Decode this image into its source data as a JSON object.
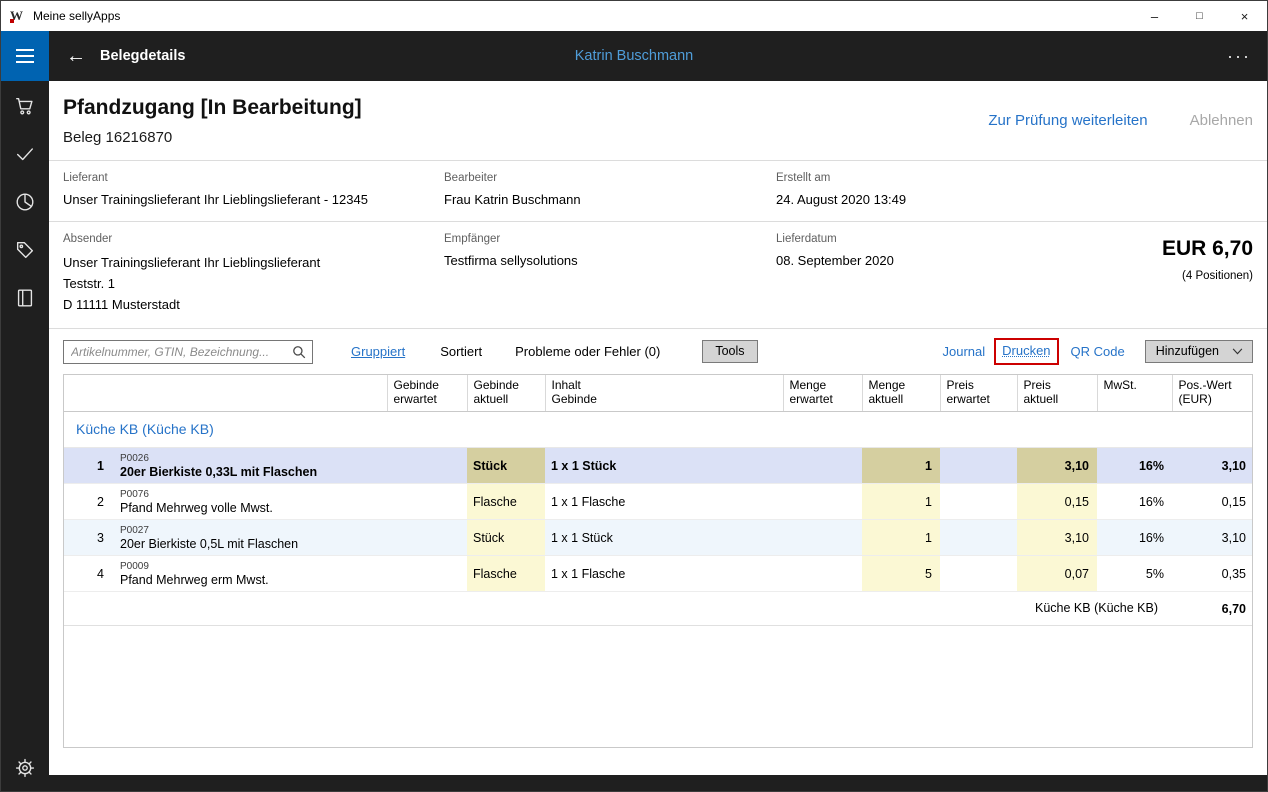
{
  "colors": {
    "accent": "#2673c8",
    "header_user_blue": "#4f9dd9",
    "hamburger_blue": "#0063b1",
    "dark_chrome": "#1f1f1f",
    "selected_row": "#dbe1f6",
    "editable_cell_yellow": "#fbf8d4",
    "editable_cell_selected_khaki": "#d5cfa0",
    "focus_highlight_red": "#cc0000"
  },
  "window": {
    "title": "Meine sellyApps",
    "minimize": "–",
    "maximize": "□",
    "close": "×"
  },
  "header": {
    "back": "←",
    "title": "Belegdetails",
    "user": "Katrin Buschmann",
    "more": "···"
  },
  "sidebar": {
    "icons": [
      "cart-icon",
      "check-icon",
      "pie-chart-icon",
      "tag-icon",
      "book-icon",
      "gear-icon"
    ]
  },
  "document": {
    "title": "Pfandzugang [In Bearbeitung]",
    "subtitle": "Beleg 16216870",
    "forward_action": "Zur Prüfung weiterleiten",
    "reject_action": "Ablehnen",
    "fields": {
      "lieferant": {
        "label": "Lieferant",
        "value": "Unser Trainingslieferant Ihr Lieblingslieferant - 12345"
      },
      "bearbeiter": {
        "label": "Bearbeiter",
        "value": "Frau Katrin Buschmann"
      },
      "erstellt": {
        "label": "Erstellt am",
        "value": "24. August 2020 13:49"
      },
      "absender": {
        "label": "Absender",
        "line1": "Unser Trainingslieferant Ihr Lieblingslieferant",
        "line2": "Teststr. 1",
        "line3": "D 11111 Musterstadt"
      },
      "empfaenger": {
        "label": "Empfänger",
        "value": "Testfirma sellysolutions"
      },
      "lieferdatum": {
        "label": "Lieferdatum",
        "value": "08. September 2020"
      }
    },
    "total": "EUR 6,70",
    "positions": "(4 Positionen)"
  },
  "toolbar": {
    "search_placeholder": "Artikelnummer, GTIN, Bezeichnung...",
    "gruppiert": "Gruppiert",
    "sortiert": "Sortiert",
    "probleme": "Probleme oder Fehler (0)",
    "tools": "Tools",
    "journal": "Journal",
    "drucken": "Drucken",
    "qr_code": "QR Code",
    "hinzufuegen": "Hinzufügen"
  },
  "table": {
    "headers": [
      [],
      [],
      [
        "Gebinde",
        "erwartet"
      ],
      [
        "Gebinde",
        "aktuell"
      ],
      [
        "Inhalt",
        "Gebinde"
      ],
      [
        "Menge",
        "erwartet"
      ],
      [
        "Menge",
        "aktuell"
      ],
      [
        "Preis",
        "erwartet"
      ],
      [
        "Preis",
        "aktuell"
      ],
      [
        "MwSt."
      ],
      [
        "Pos.-Wert",
        "(EUR)"
      ]
    ],
    "group": "Küche KB (Küche KB)",
    "rows": [
      {
        "nr": "1",
        "code": "P0026",
        "name": "20er Bierkiste 0,33L mit Flaschen",
        "gebinde_aktuell": "Stück",
        "inhalt": "1 x 1 Stück",
        "menge_aktuell": "1",
        "preis_aktuell": "3,10",
        "mwst": "16%",
        "wert": "3,10"
      },
      {
        "nr": "2",
        "code": "P0076",
        "name": "Pfand Mehrweg volle Mwst.",
        "gebinde_aktuell": "Flasche",
        "inhalt": "1 x 1 Flasche",
        "menge_aktuell": "1",
        "preis_aktuell": "0,15",
        "mwst": "16%",
        "wert": "0,15"
      },
      {
        "nr": "3",
        "code": "P0027",
        "name": "20er Bierkiste 0,5L mit Flaschen",
        "gebinde_aktuell": "Stück",
        "inhalt": "1 x 1 Stück",
        "menge_aktuell": "1",
        "preis_aktuell": "3,10",
        "mwst": "16%",
        "wert": "3,10"
      },
      {
        "nr": "4",
        "code": "P0009",
        "name": "Pfand Mehrweg erm Mwst.",
        "gebinde_aktuell": "Flasche",
        "inhalt": "1 x 1 Flasche",
        "menge_aktuell": "5",
        "preis_aktuell": "0,07",
        "mwst": "5%",
        "wert": "0,35"
      }
    ],
    "footer": {
      "label": "Küche KB (Küche KB)",
      "total": "6,70"
    }
  }
}
